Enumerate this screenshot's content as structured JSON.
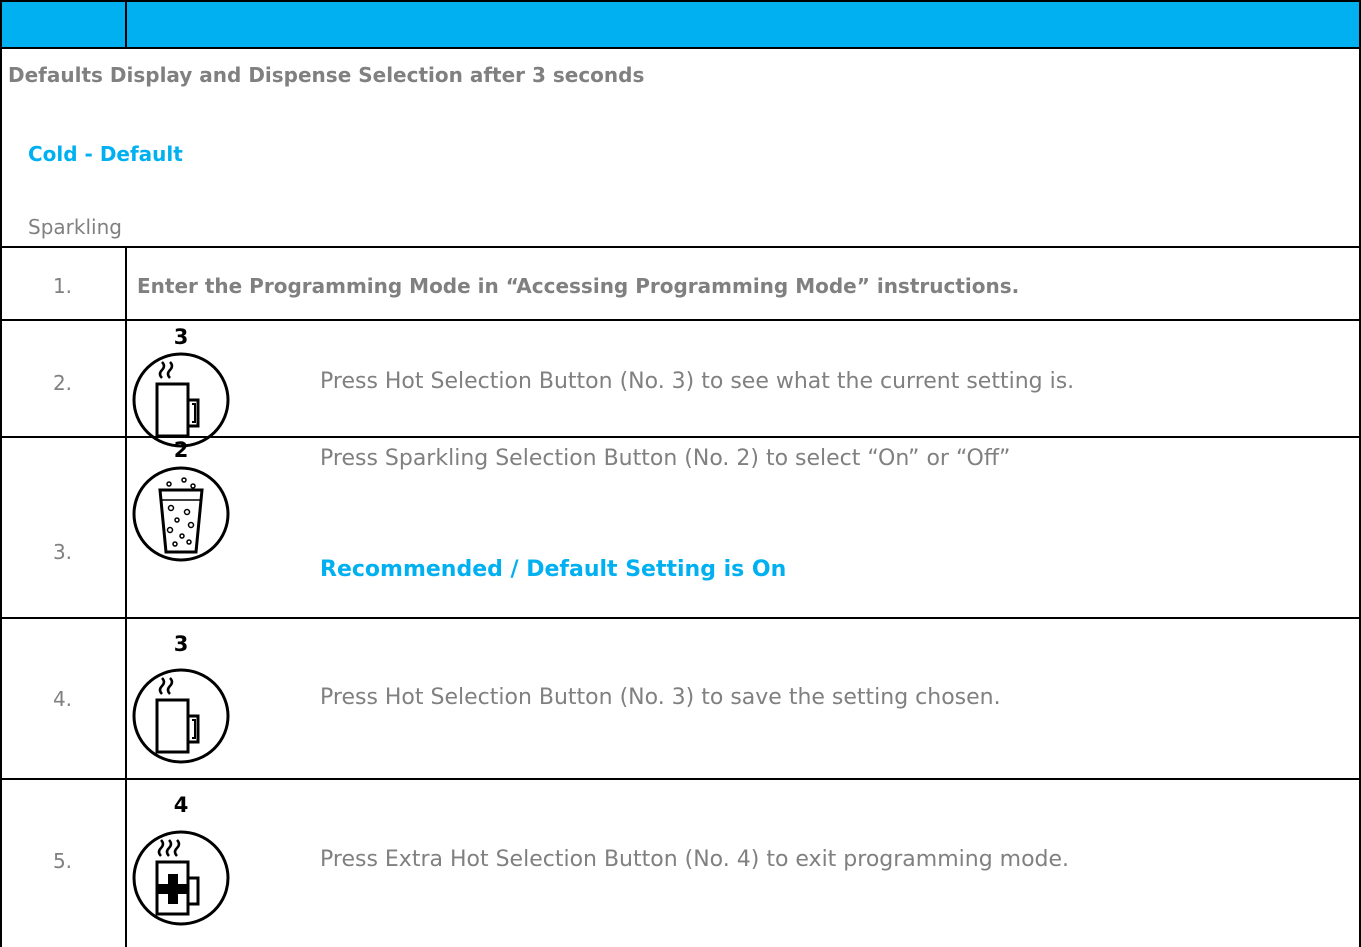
{
  "intro": {
    "title": "Defaults Display and Dispense Selection after 3 seconds",
    "default_option": "Cold - Default",
    "other_option": "Sparkling"
  },
  "steps": [
    {
      "number": "1.",
      "text": "Enter the Programming Mode in “Accessing Programming Mode” instructions."
    },
    {
      "number": "2.",
      "button_no": "3",
      "icon": "hot-mug-icon",
      "text": "Press Hot Selection Button (No. 3) to see what the current setting is."
    },
    {
      "number": "3.",
      "button_no": "2",
      "icon": "sparkling-glass-icon",
      "text": "Press Sparkling Selection Button (No. 2) to select “On” or “Off”",
      "note": "Recommended / Default Setting is On"
    },
    {
      "number": "4.",
      "button_no": "3",
      "icon": "hot-mug-icon",
      "text": "Press Hot Selection Button (No. 3) to save the setting chosen."
    },
    {
      "number": "5.",
      "button_no": "4",
      "icon": "extra-hot-mug-icon",
      "text": "Press Extra Hot Selection Button (No. 4) to exit programming mode."
    }
  ],
  "colors": {
    "accent": "#00b0f0",
    "body_text": "#808080",
    "border": "#000000"
  }
}
